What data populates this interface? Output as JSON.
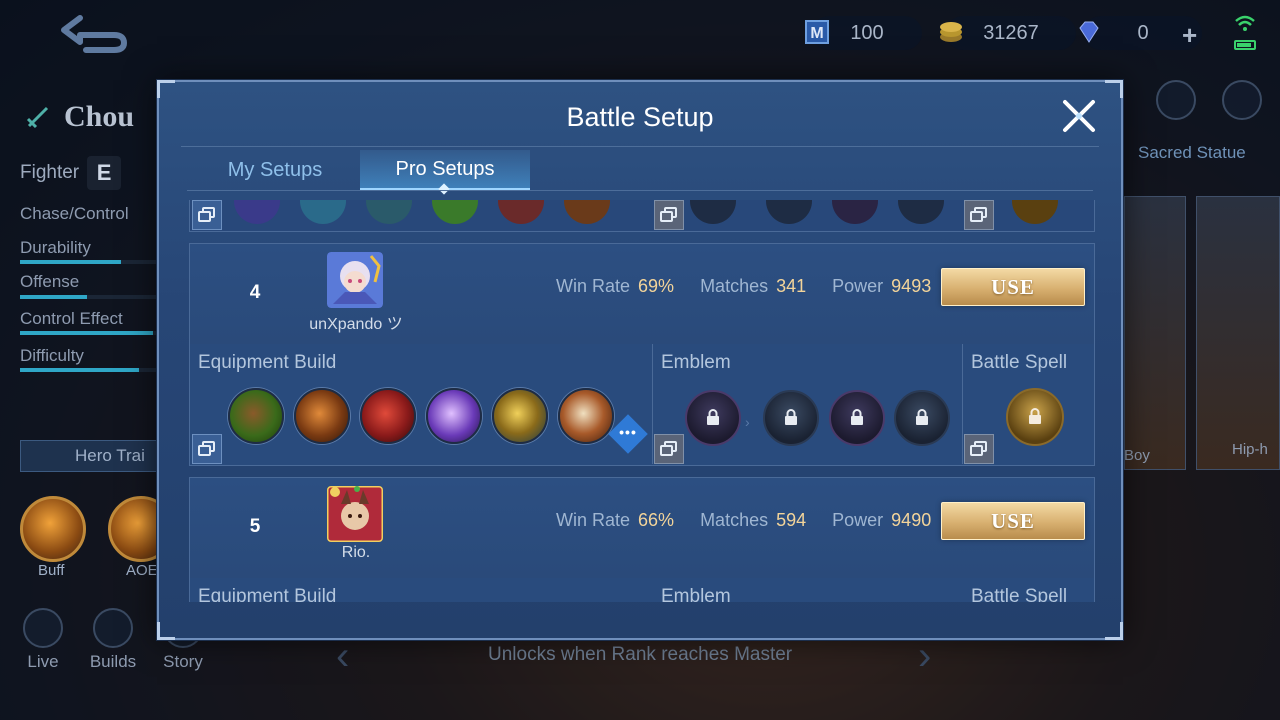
{
  "top_bar": {
    "ticket_value": "100",
    "gold_value": "31267",
    "diamond_value": "0"
  },
  "hero": {
    "name": "Chou",
    "role": "Fighter",
    "specialty": "Chase/Control",
    "stats": [
      {
        "label": "Durability",
        "level": 0.72
      },
      {
        "label": "Offense",
        "level": 0.48
      },
      {
        "label": "Control Effect",
        "level": 0.95
      },
      {
        "label": "Difficulty",
        "level": 0.85
      }
    ],
    "hero_training_label": "Hero Trai",
    "skills": [
      {
        "label": "Buff"
      },
      {
        "label": "AOE"
      }
    ]
  },
  "bottom_nav": [
    {
      "label": "Live",
      "icon": "live-icon"
    },
    {
      "label": "Builds",
      "icon": "builds-icon"
    },
    {
      "label": "Story",
      "icon": "story-icon"
    }
  ],
  "right_panel": {
    "sacred_statue_label": "Sacred Statue",
    "skin_labels": [
      "Boy",
      "Hip-h"
    ]
  },
  "unlock_text": "Unlocks when Rank reaches Master",
  "modal": {
    "title": "Battle Setup",
    "tabs": [
      {
        "label": "My Setups",
        "active": false
      },
      {
        "label": "Pro Setups",
        "active": true
      }
    ],
    "section_labels": {
      "equipment": "Equipment Build",
      "emblem": "Emblem",
      "spell": "Battle Spell"
    },
    "stat_labels": {
      "win_rate": "Win Rate",
      "matches": "Matches",
      "power": "Power"
    },
    "use_label": "USE",
    "setups": [
      {
        "rank": "4",
        "player": "unXpando ツ",
        "win_rate": "69%",
        "matches": "341",
        "power": "9493",
        "equipment_icons": [
          "boots-item-icon",
          "axe-item-icon",
          "spear-item-icon",
          "blade-item-icon",
          "golden-staff-item-icon",
          "gauntlet-item-icon"
        ],
        "emblem_icons": [
          "emblem-main-icon",
          "emblem-talent-1-icon",
          "emblem-talent-2-icon",
          "emblem-talent-3-icon"
        ],
        "spell_icon": "battle-spell-icon"
      },
      {
        "rank": "5",
        "player": "Rio.",
        "win_rate": "66%",
        "matches": "594",
        "power": "9490"
      }
    ]
  },
  "colors": {
    "modal_bg": "#274676",
    "accent_gold": "#f3d49a",
    "use_button": "#d8b070",
    "tab_active": "#9fd6ff"
  }
}
